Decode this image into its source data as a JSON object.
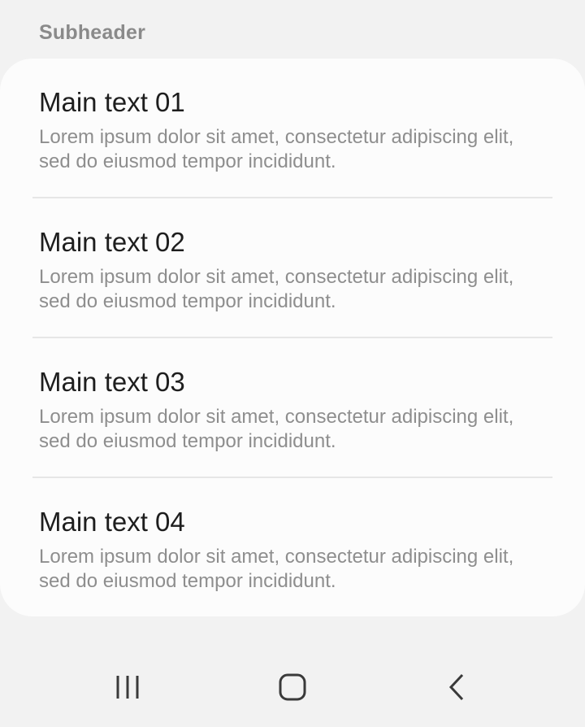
{
  "subheader": "Subheader",
  "items": [
    {
      "title": "Main text 01",
      "description": "Lorem ipsum dolor sit amet, consectetur adipiscing elit, sed do eiusmod tempor incididunt."
    },
    {
      "title": "Main text 02",
      "description": "Lorem ipsum dolor sit amet, consectetur adipiscing elit, sed do eiusmod tempor incididunt."
    },
    {
      "title": "Main text 03",
      "description": "Lorem ipsum dolor sit amet, consectetur adipiscing elit, sed do eiusmod tempor incididunt."
    },
    {
      "title": "Main text 04",
      "description": "Lorem ipsum dolor sit amet, consectetur adipiscing elit, sed do eiusmod tempor incididunt."
    }
  ],
  "navbar": {
    "recents_icon": "recents-icon",
    "home_icon": "home-icon",
    "back_icon": "back-icon"
  },
  "colors": {
    "background": "#f2f2f2",
    "card": "#fcfcfc",
    "primary_text": "#1e1e1e",
    "secondary_text": "#8e8e8e"
  }
}
